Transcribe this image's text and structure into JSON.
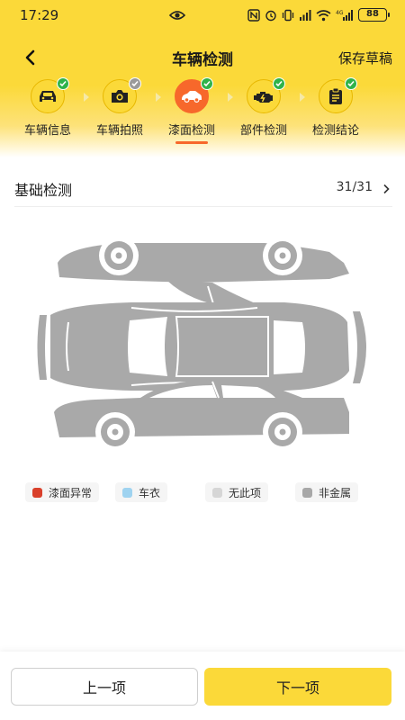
{
  "status_bar": {
    "time": "17:29",
    "battery": "88",
    "network": "4G"
  },
  "header": {
    "title": "车辆检测",
    "save_draft": "保存草稿"
  },
  "steps": [
    {
      "label": "车辆信息",
      "icon": "car-front-icon",
      "status": "done"
    },
    {
      "label": "车辆拍照",
      "icon": "camera-icon",
      "status": "pending"
    },
    {
      "label": "漆面检测",
      "icon": "car-paint-icon",
      "status": "active"
    },
    {
      "label": "部件检测",
      "icon": "engine-icon",
      "status": "done"
    },
    {
      "label": "检测结论",
      "icon": "clipboard-icon",
      "status": "done"
    }
  ],
  "section": {
    "title": "基础检测",
    "count": "31/31"
  },
  "legend": [
    {
      "label": "漆面异常",
      "color": "#d9402b"
    },
    {
      "label": "车衣",
      "color": "#9fd3f0"
    },
    {
      "label": "无此项",
      "color": "#d6d6d6"
    },
    {
      "label": "非金属",
      "color": "#a8a8a8"
    }
  ],
  "colors": {
    "brand_yellow": "#fbd939",
    "active_orange": "#f7682b",
    "check_green": "#2fb34a",
    "car_body": "#a9a9a9"
  },
  "footer": {
    "prev_label": "上一项",
    "next_label": "下一项"
  }
}
